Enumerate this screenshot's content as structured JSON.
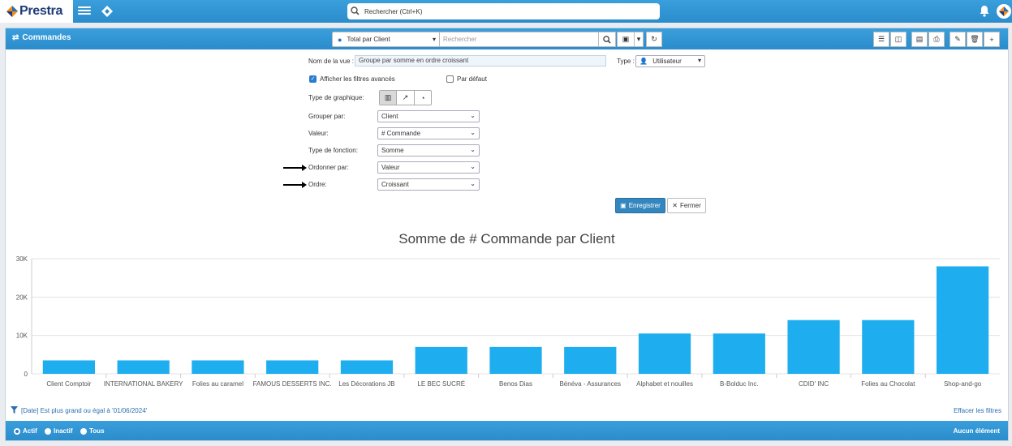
{
  "app": {
    "logo_text": "Prestra"
  },
  "topbar": {
    "search_placeholder": "Rechercher (Ctrl+K)"
  },
  "header": {
    "title": "Commandes",
    "view_select": "Total par Client",
    "search_placeholder": "Rechercher"
  },
  "form": {
    "view_name_label": "Nom de la vue :",
    "view_name_value": "Groupe par somme en ordre croissant",
    "type_label": "Type :",
    "type_value": "Utilisateur",
    "advanced_filters_label": "Afficher les filtres avancés",
    "advanced_filters_checked": true,
    "default_label": "Par défaut",
    "default_checked": false,
    "chart_type_label": "Type de graphique:",
    "group_by_label": "Grouper par:",
    "group_by_value": "Client",
    "value_label": "Valeur:",
    "value_value": "# Commande",
    "function_type_label": "Type de fonction:",
    "function_type_value": "Somme",
    "order_by_label": "Ordonner par:",
    "order_by_value": "Valeur",
    "order_label": "Ordre:",
    "order_value": "Croissant",
    "save_label": "Enregistrer",
    "close_label": "Fermer"
  },
  "chart_data": {
    "type": "bar",
    "title": "Somme de # Commande par Client",
    "categories": [
      "Client Comptoir",
      "INTERNATIONAL BAKERY",
      "Folies au caramel",
      "FAMOUS DESSERTS INC.",
      "Les Décorations JB",
      "LE BEC SUCRÉ",
      "Benos Dias",
      "Bénéva - Assurances",
      "Alphabet et nouilles",
      "B-Bolduc Inc.",
      "CDID' INC",
      "Folies au Chocolat",
      "Shop-and-go"
    ],
    "values": [
      3500,
      3500,
      3500,
      3500,
      3500,
      7000,
      7000,
      7000,
      10500,
      10500,
      14000,
      14000,
      28000
    ],
    "ylim": [
      0,
      30000
    ],
    "yticks": [
      0,
      10000,
      20000,
      30000
    ],
    "ytick_labels": [
      "0",
      "10K",
      "20K",
      "30K"
    ],
    "grid": true,
    "bar_color": "#1eaef0"
  },
  "footer": {
    "filter_text": "[Date] Est plus grand ou égal à '01/06/2024'",
    "clear_filters": "Effacer les filtres",
    "radio_active": "Actif",
    "radio_inactive": "Inactif",
    "radio_all": "Tous",
    "count_text": "Aucun élément"
  },
  "colors": {
    "accent": "#2b8ccb",
    "bar": "#1eaef0",
    "link": "#2a6fb0"
  }
}
